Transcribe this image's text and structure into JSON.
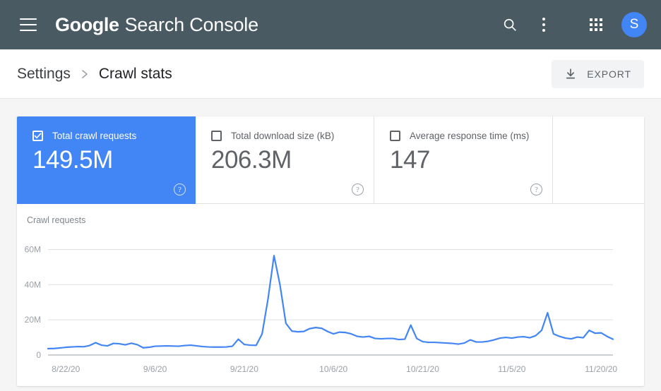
{
  "appbar": {
    "menu_icon": "hamburger-icon",
    "brand_primary": "Google",
    "brand_secondary": "Search Console",
    "search_icon": "search-icon",
    "more_icon": "kebab-menu-icon",
    "apps_icon": "apps-grid-icon",
    "avatar_initial": "S",
    "avatar_color": "#4285f4",
    "background": "#4a5a63"
  },
  "breadcrumb": {
    "parent": "Settings",
    "separator": "›",
    "current": "Crawl stats"
  },
  "export": {
    "label": "EXPORT",
    "icon": "download-icon"
  },
  "cards": [
    {
      "label": "Total crawl requests",
      "value": "149.5M",
      "checked": true,
      "selected": true,
      "help_icon": "help-circle-icon",
      "accent": "#4285f4"
    },
    {
      "label": "Total download size (kB)",
      "value": "206.3M",
      "checked": false,
      "selected": false,
      "help_icon": "help-circle-icon"
    },
    {
      "label": "Average response time (ms)",
      "value": "147",
      "checked": false,
      "selected": false,
      "help_icon": "help-circle-icon"
    }
  ],
  "chart_data": {
    "type": "line",
    "title": "Crawl requests",
    "xlabel": "",
    "ylabel": "",
    "ylim": [
      0,
      65
    ],
    "y_unit": "M",
    "y_ticks": [
      0,
      20,
      40,
      60
    ],
    "y_tick_labels": [
      "0",
      "20M",
      "40M",
      "60M"
    ],
    "grid": true,
    "legend": "none",
    "line_color": "#4285f4",
    "x_tick_labels": [
      "8/22/20",
      "9/6/20",
      "9/21/20",
      "10/6/20",
      "10/21/20",
      "11/5/20",
      "11/20/20"
    ],
    "x_tick_indices": [
      3,
      18,
      33,
      48,
      63,
      78,
      93
    ],
    "x": [
      "8/19/20",
      "8/20/20",
      "8/21/20",
      "8/22/20",
      "8/23/20",
      "8/24/20",
      "8/25/20",
      "8/26/20",
      "8/27/20",
      "8/28/20",
      "8/29/20",
      "8/30/20",
      "8/31/20",
      "9/1/20",
      "9/2/20",
      "9/3/20",
      "9/4/20",
      "9/5/20",
      "9/6/20",
      "9/7/20",
      "9/8/20",
      "9/9/20",
      "9/10/20",
      "9/11/20",
      "9/12/20",
      "9/13/20",
      "9/14/20",
      "9/15/20",
      "9/16/20",
      "9/17/20",
      "9/18/20",
      "9/19/20",
      "9/20/20",
      "9/21/20",
      "9/22/20",
      "9/23/20",
      "9/24/20",
      "9/25/20",
      "9/26/20",
      "9/27/20",
      "9/28/20",
      "9/29/20",
      "9/30/20",
      "10/1/20",
      "10/2/20",
      "10/3/20",
      "10/4/20",
      "10/5/20",
      "10/6/20",
      "10/7/20",
      "10/8/20",
      "10/9/20",
      "10/10/20",
      "10/11/20",
      "10/12/20",
      "10/13/20",
      "10/14/20",
      "10/15/20",
      "10/16/20",
      "10/17/20",
      "10/18/20",
      "10/19/20",
      "10/20/20",
      "10/21/20",
      "10/22/20",
      "10/23/20",
      "10/24/20",
      "10/25/20",
      "10/26/20",
      "10/27/20",
      "10/28/20",
      "10/29/20",
      "10/30/20",
      "10/31/20",
      "11/1/20",
      "11/2/20",
      "11/3/20",
      "11/4/20",
      "11/5/20",
      "11/6/20",
      "11/7/20",
      "11/8/20",
      "11/9/20",
      "11/10/20",
      "11/11/20",
      "11/12/20",
      "11/13/20",
      "11/14/20",
      "11/15/20",
      "11/16/20",
      "11/17/20",
      "11/18/20",
      "11/19/20",
      "11/20/20",
      "11/21/20",
      "11/22/20"
    ],
    "values": [
      3.6,
      3.7,
      4.0,
      4.4,
      4.6,
      4.8,
      4.7,
      5.4,
      7.0,
      5.6,
      5.2,
      6.6,
      6.4,
      5.8,
      6.7,
      5.9,
      4.1,
      4.4,
      5.0,
      5.1,
      5.2,
      5.1,
      5.0,
      5.4,
      5.6,
      5.2,
      4.8,
      4.6,
      4.5,
      4.5,
      4.6,
      5.0,
      9.0,
      6.0,
      5.6,
      5.5,
      12.0,
      32.0,
      56.5,
      40.0,
      18.0,
      13.6,
      13.2,
      13.4,
      15.0,
      15.6,
      15.2,
      13.4,
      12.0,
      13.0,
      12.8,
      12.0,
      10.6,
      10.2,
      10.6,
      9.4,
      9.2,
      9.4,
      9.4,
      8.8,
      9.0,
      17.0,
      9.4,
      7.6,
      7.2,
      7.2,
      7.0,
      6.8,
      6.6,
      6.2,
      6.8,
      8.6,
      7.4,
      7.4,
      7.8,
      8.6,
      9.6,
      10.0,
      9.6,
      10.2,
      10.4,
      9.8,
      11.0,
      14.0,
      24.0,
      12.0,
      10.6,
      9.6,
      9.2,
      10.2,
      9.8,
      14.0,
      12.4,
      12.6,
      10.6,
      9.0
    ]
  }
}
